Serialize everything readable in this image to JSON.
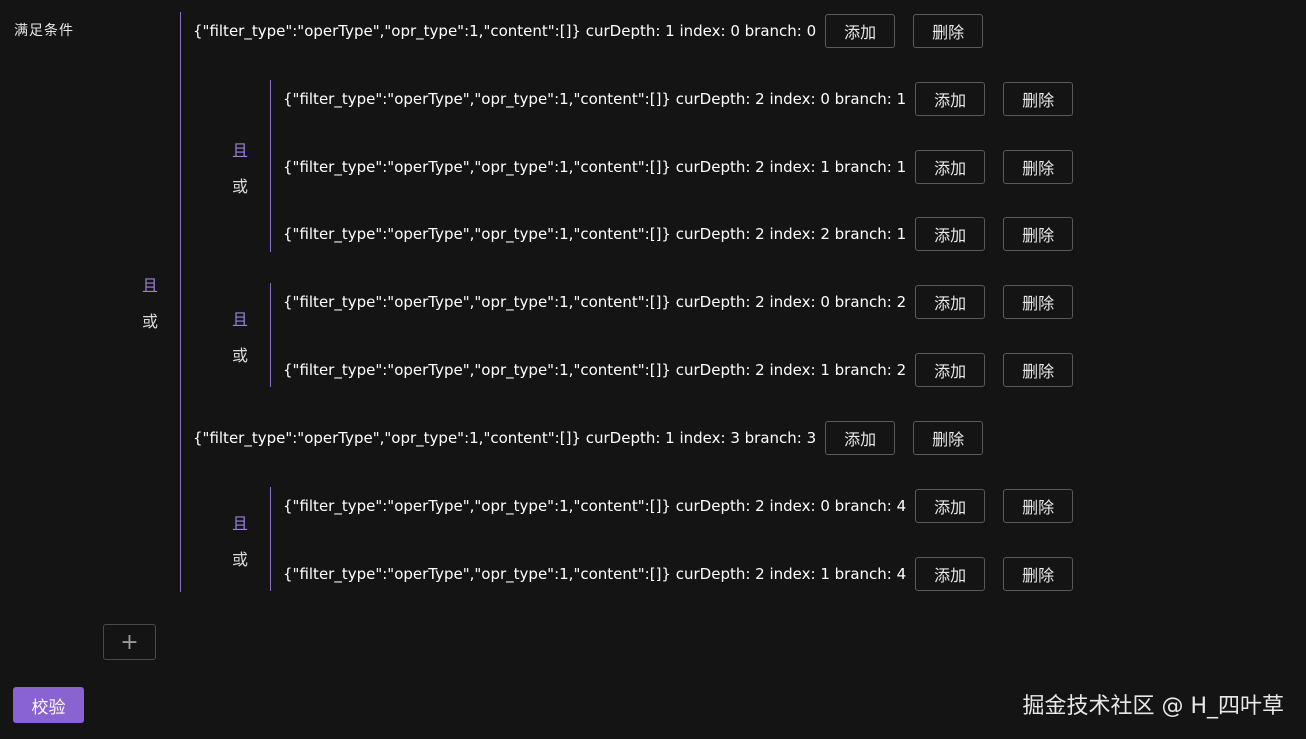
{
  "label": "满足条件",
  "connector_and": "且",
  "connector_or": "或",
  "add_label": "添加",
  "delete_label": "删除",
  "plus_label": "+",
  "verify_label": "校验",
  "watermark": "掘金技术社区 @ H_四叶草",
  "rows": [
    {
      "text": "{\"filter_type\":\"operType\",\"opr_type\":1,\"content\":[]} curDepth: 1 index: 0 branch: 0"
    },
    {
      "text": "{\"filter_type\":\"operType\",\"opr_type\":1,\"content\":[]} curDepth: 2 index: 0 branch: 1"
    },
    {
      "text": "{\"filter_type\":\"operType\",\"opr_type\":1,\"content\":[]} curDepth: 2 index: 1 branch: 1"
    },
    {
      "text": "{\"filter_type\":\"operType\",\"opr_type\":1,\"content\":[]} curDepth: 2 index: 2 branch: 1"
    },
    {
      "text": "{\"filter_type\":\"operType\",\"opr_type\":1,\"content\":[]} curDepth: 2 index: 0 branch: 2"
    },
    {
      "text": "{\"filter_type\":\"operType\",\"opr_type\":1,\"content\":[]} curDepth: 2 index: 1 branch: 2"
    },
    {
      "text": "{\"filter_type\":\"operType\",\"opr_type\":1,\"content\":[]} curDepth: 1 index: 3 branch: 3"
    },
    {
      "text": "{\"filter_type\":\"operType\",\"opr_type\":1,\"content\":[]} curDepth: 2 index: 0 branch: 4"
    },
    {
      "text": "{\"filter_type\":\"operType\",\"opr_type\":1,\"content\":[]} curDepth: 2 index: 1 branch: 4"
    }
  ]
}
